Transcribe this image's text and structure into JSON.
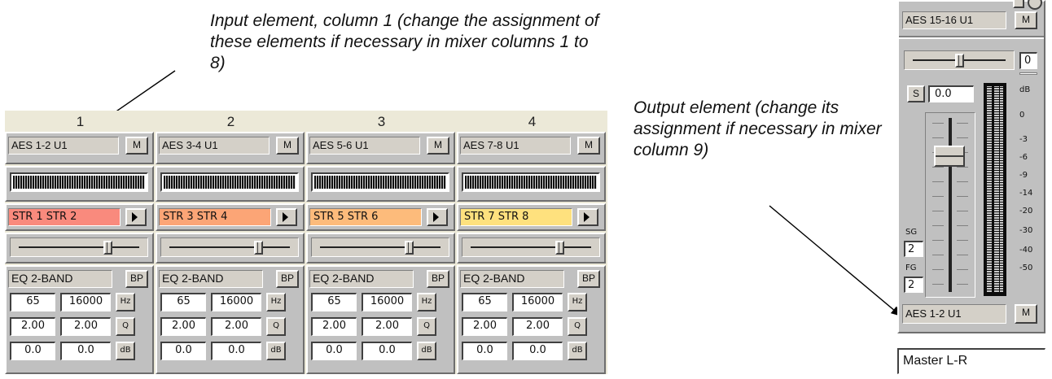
{
  "annotations": {
    "input_text": "Input element, column 1 (change the assignment of these elements if necessary in mixer columns 1 to 8)",
    "output_text": "Output element (change its assignment if necessary in mixer column 9)"
  },
  "channels": [
    {
      "column": "1",
      "input": "AES 1-2 U1",
      "mute": "M",
      "record": "STR 1 STR 2",
      "record_color": "#f98a7d",
      "eq_label": "EQ 2-BAND",
      "bypass": "BP",
      "freq": [
        "65",
        "16000"
      ],
      "freq_unit": "Hz",
      "q": [
        "2.00",
        "2.00"
      ],
      "q_unit": "Q",
      "gain": [
        "0.0",
        "0.0"
      ],
      "gain_unit": "dB",
      "pan": 0.75
    },
    {
      "column": "2",
      "input": "AES 3-4 U1",
      "mute": "M",
      "record": "STR 3 STR 4",
      "record_color": "#fca576",
      "eq_label": "EQ 2-BAND",
      "bypass": "BP",
      "freq": [
        "65",
        "16000"
      ],
      "freq_unit": "Hz",
      "q": [
        "2.00",
        "2.00"
      ],
      "q_unit": "Q",
      "gain": [
        "0.0",
        "0.0"
      ],
      "gain_unit": "dB",
      "pan": 0.75
    },
    {
      "column": "3",
      "input": "AES 5-6 U1",
      "mute": "M",
      "record": "STR 5 STR 6",
      "record_color": "#fdbb7b",
      "eq_label": "EQ 2-BAND",
      "bypass": "BP",
      "freq": [
        "65",
        "16000"
      ],
      "freq_unit": "Hz",
      "q": [
        "2.00",
        "2.00"
      ],
      "q_unit": "Q",
      "gain": [
        "0.0",
        "0.0"
      ],
      "gain_unit": "dB",
      "pan": 0.75
    },
    {
      "column": "4",
      "input": "AES 7-8 U1",
      "mute": "M",
      "record": "STR 7 STR 8",
      "record_color": "#fee17e",
      "eq_label": "EQ 2-BAND",
      "bypass": "BP",
      "freq": [
        "65",
        "16000"
      ],
      "freq_unit": "Hz",
      "q": [
        "2.00",
        "2.00"
      ],
      "q_unit": "Q",
      "gain": [
        "0.0",
        "0.0"
      ],
      "gain_unit": "dB",
      "pan": 0.75
    }
  ],
  "output": {
    "top_input": "AES 15-16 U1",
    "top_mute": "M",
    "balance_value": "0",
    "solo": "S",
    "gain": "0.0",
    "scale": [
      "dB",
      "0",
      "-3",
      "-6",
      "-9",
      "-14",
      "-20",
      "-30",
      "-40",
      "-50"
    ],
    "sg_label": "SG",
    "sg_value": "2",
    "fg_label": "FG",
    "fg_value": "2",
    "output_assign": "AES 1-2 U1",
    "output_mute": "M",
    "fader_level": 0.82,
    "balance": 0.5
  },
  "master": "Master L-R"
}
